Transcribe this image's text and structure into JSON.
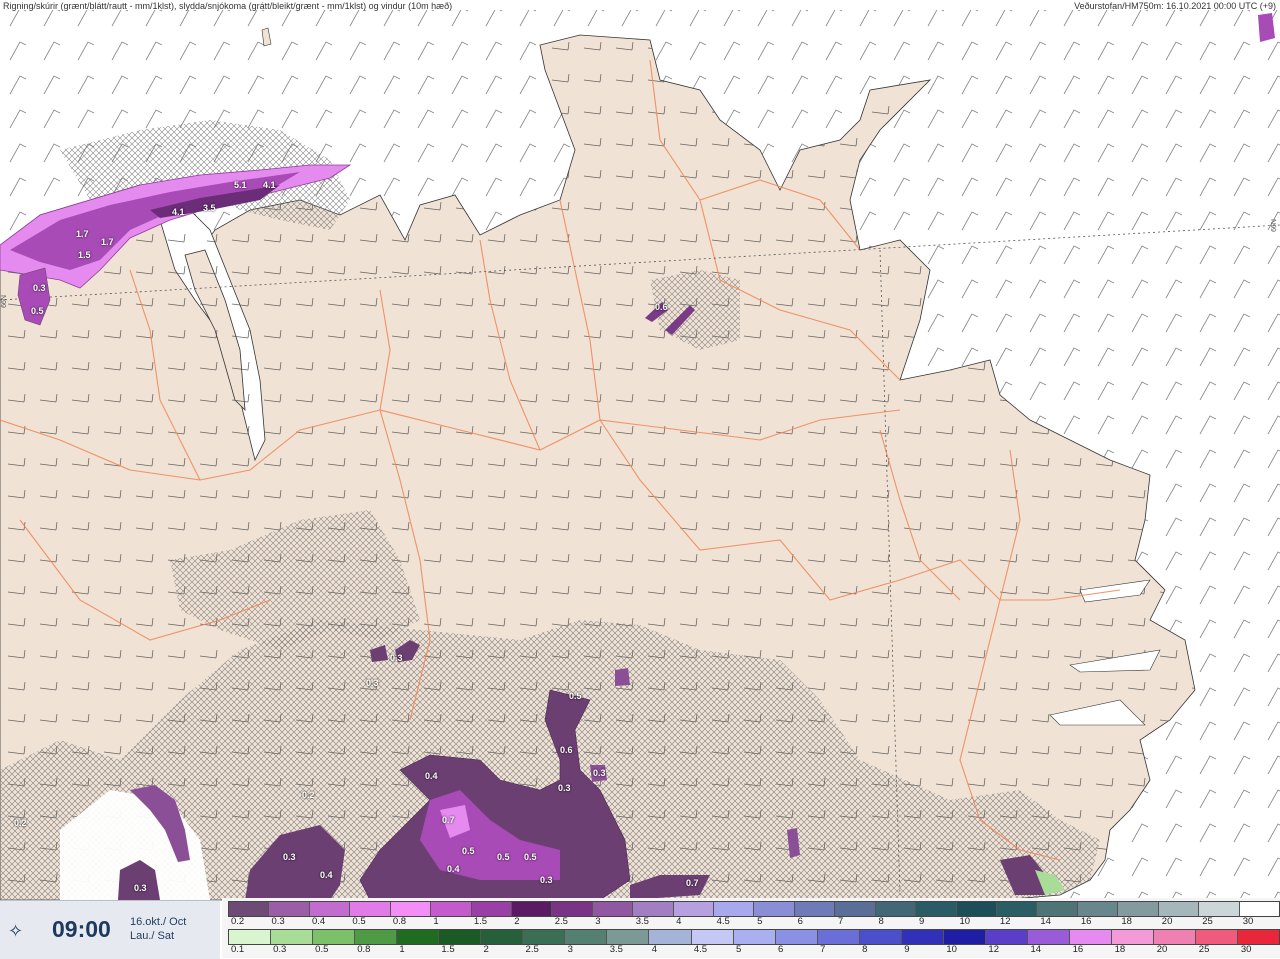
{
  "header": {
    "left_title": "Rigning/skúrir (grænt/blátt/rautt - mm/1klst), slydda/snjókoma (grátt/bleikt/grænt - mm/1klst) og vindur (10m hæð)",
    "right_title": "Veðurstofan/HM750m: 16.10.2021 00:00 UTC (+9)"
  },
  "latitude_labels": {
    "left": "66N",
    "right": "66N"
  },
  "time_panel": {
    "icon": "wind-compass-icon",
    "time": "09:00",
    "date_line1": "16.okt./ Oct",
    "date_line2": "Lau./ Sat"
  },
  "colors": {
    "land": "#f0e2d5",
    "sea": "#ffffff",
    "roads": "#f08a5a",
    "snow_dark": "#6b3f72",
    "snow_mid": "#a94bb6",
    "snow_light": "#e58bef"
  },
  "legend": {
    "snow_row": {
      "labels": [
        "0.2",
        "0.3",
        "0.4",
        "0.5",
        "0.8",
        "1",
        "1.5",
        "2",
        "2.5",
        "3",
        "3.5",
        "4",
        "4.5",
        "5",
        "6",
        "7",
        "8",
        "9",
        "10",
        "12",
        "14",
        "16",
        "18",
        "20",
        "25",
        "30"
      ],
      "colors": [
        "#6e4a76",
        "#9a5ea7",
        "#c36ccf",
        "#e07be8",
        "#f28ef5",
        "#c45bcc",
        "#9a3fa6",
        "#5a1b62",
        "#7a3486",
        "#9157a1",
        "#a27ec3",
        "#b6a0e0",
        "#a7a9ec",
        "#8a8ed6",
        "#6f7ab8",
        "#5a6f98",
        "#426878",
        "#2a5c66",
        "#1d4f58",
        "#2b5d64",
        "#4e7478",
        "#67878c",
        "#839b9e",
        "#a5b7ba",
        "#cad6d8",
        "#ffffff"
      ]
    },
    "rain_row": {
      "labels": [
        "0.1",
        "0.3",
        "0.5",
        "0.8",
        "1",
        "1.5",
        "2",
        "2.5",
        "3",
        "3.5",
        "4",
        "4.5",
        "5",
        "6",
        "7",
        "8",
        "9",
        "10",
        "12",
        "14",
        "16",
        "18",
        "20",
        "25",
        "30"
      ],
      "colors": [
        "#d8f5cf",
        "#a9dc97",
        "#7cc06a",
        "#4f9a45",
        "#1f6b1f",
        "#1a5a24",
        "#25603a",
        "#3a6f55",
        "#557f70",
        "#7c9a95",
        "#a4b4d8",
        "#c5c8f4",
        "#aab0ef",
        "#8a90e4",
        "#6a6fd8",
        "#4b4fcc",
        "#3030b8",
        "#1e1ea4",
        "#5a3ec9",
        "#9a5bd8",
        "#e58bef",
        "#f49ad8",
        "#f07fb2",
        "#ef5a7d",
        "#e8283a"
      ]
    }
  },
  "precip_values": [
    {
      "label": "5.1"
    },
    {
      "label": "4.1"
    },
    {
      "label": "4.1"
    },
    {
      "label": "3.5"
    },
    {
      "label": "1.7"
    },
    {
      "label": "1.7"
    },
    {
      "label": "1.5"
    },
    {
      "label": "0.3"
    },
    {
      "label": "0.5"
    },
    {
      "label": "0.6"
    },
    {
      "label": "0.3"
    },
    {
      "label": "0.3"
    },
    {
      "label": "0.5"
    },
    {
      "label": "0.6"
    },
    {
      "label": "0.4"
    },
    {
      "label": "0.3"
    },
    {
      "label": "0.3"
    },
    {
      "label": "0.7"
    },
    {
      "label": "0.5"
    },
    {
      "label": "0.5"
    },
    {
      "label": "0.5"
    },
    {
      "label": "0.4"
    },
    {
      "label": "0.3"
    },
    {
      "label": "0.4"
    },
    {
      "label": "0.3"
    },
    {
      "label": "0.7"
    },
    {
      "label": "0.2"
    },
    {
      "label": "0.2"
    },
    {
      "label": "0.3"
    }
  ]
}
